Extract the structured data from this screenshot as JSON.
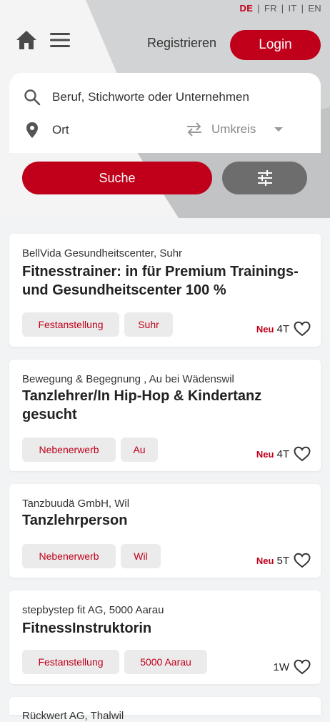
{
  "header": {
    "languages": [
      "DE",
      "FR",
      "IT",
      "EN"
    ],
    "active_language": "DE",
    "register_label": "Registrieren",
    "login_label": "Login"
  },
  "search": {
    "keyword_placeholder": "Beruf, Stichworte oder Unternehmen",
    "location_placeholder": "Ort",
    "radius_label": "Umkreis",
    "search_button": "Suche"
  },
  "jobs": [
    {
      "company": "BellVida Gesundheitscenter, Suhr",
      "title": "Fitnesstrainer: in für Premium Trainings- und Gesundheitscenter 100 %",
      "tags": [
        "Festanstellung",
        "Suhr"
      ],
      "new_label": "Neu",
      "age": "4T"
    },
    {
      "company": "Bewegung & Begegnung , Au bei Wädenswil",
      "title": "Tanzlehrer/In Hip-Hop & Kindertanz gesucht",
      "tags": [
        "Nebenerwerb",
        "Au"
      ],
      "new_label": "Neu",
      "age": "4T"
    },
    {
      "company": "Tanzbuudä GmbH, Wil",
      "title": "Tanzlehrperson",
      "tags": [
        "Nebenerwerb",
        "Wil"
      ],
      "new_label": "Neu",
      "age": "5T"
    },
    {
      "company": "stepbystep fit AG, 5000 Aarau",
      "title": "FitnessInstruktorin",
      "tags": [
        "Festanstellung",
        "5000 Aarau"
      ],
      "new_label": "",
      "age": "1W"
    },
    {
      "company": "Rückwert AG, Thalwil",
      "title": "",
      "tags": [],
      "new_label": "",
      "age": ""
    }
  ],
  "colors": {
    "brand_red": "#c0001a",
    "filter_gray": "#6d6d6d"
  }
}
